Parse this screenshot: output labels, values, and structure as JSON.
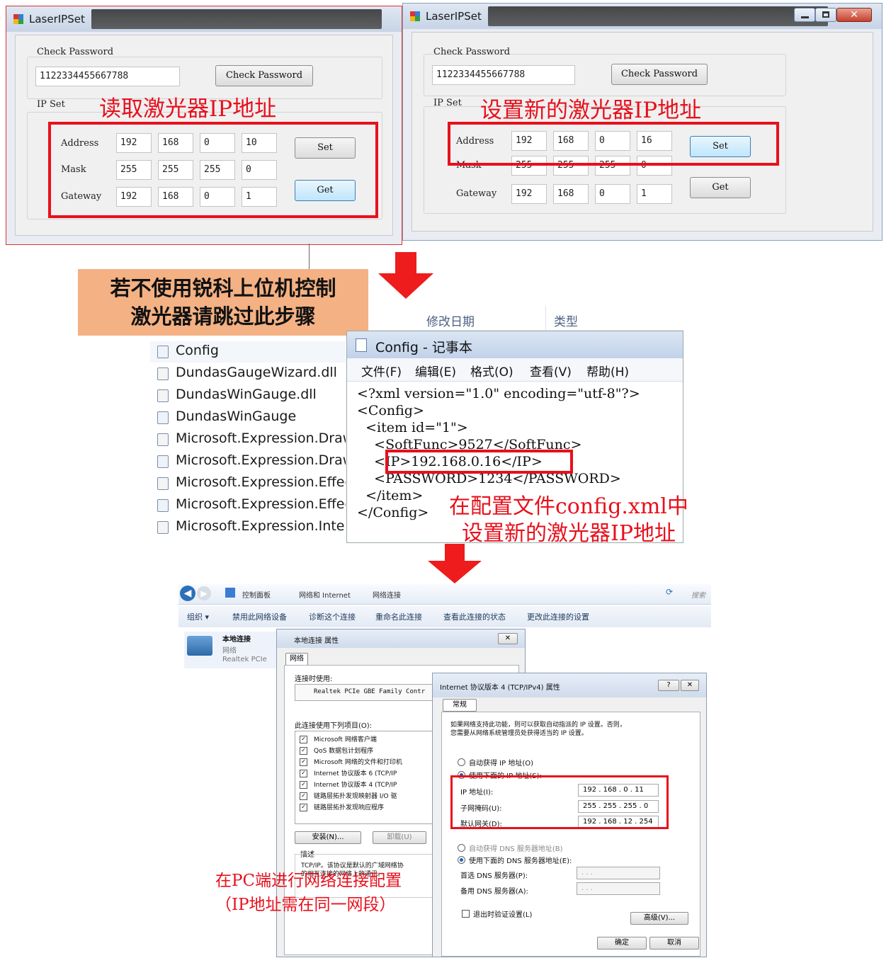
{
  "left_window": {
    "title": "LaserIPSet",
    "check_password_label": "Check Password",
    "password_value": "1122334455667788",
    "check_password_button": "Check Password",
    "ip_set_label": "IP Set",
    "annotation": "读取激光器IP地址",
    "address_label": "Address",
    "mask_label": "Mask",
    "gateway_label": "Gateway",
    "address": [
      "192",
      "168",
      "0",
      "10"
    ],
    "mask": [
      "255",
      "255",
      "255",
      "0"
    ],
    "gateway": [
      "192",
      "168",
      "0",
      "1"
    ],
    "set_button": "Set",
    "get_button": "Get"
  },
  "right_window": {
    "title": "LaserIPSet",
    "check_password_label": "Check Password",
    "password_value": "1122334455667788",
    "check_password_button": "Check Password",
    "ip_set_label": "IP Set",
    "annotation": "设置新的激光器IP地址",
    "address_label": "Address",
    "mask_label": "Mask",
    "gateway_label": "Gateway",
    "address": [
      "192",
      "168",
      "0",
      "16"
    ],
    "mask": [
      "255",
      "255",
      "255",
      "0"
    ],
    "gateway": [
      "192",
      "168",
      "0",
      "1"
    ],
    "set_button": "Set",
    "get_button": "Get",
    "minimize_icon": "minimize-icon",
    "maximize_icon": "maximize-icon",
    "close_icon": "close-icon"
  },
  "note": {
    "line1": "若不使用锐科上位机控制",
    "line2": "激光器请跳过此步骤"
  },
  "explorer": {
    "col_modified": "修改日期",
    "col_type": "类型",
    "files": [
      "Config",
      "DundasGaugeWizard.dll",
      "DundasWinGauge.dll",
      "DundasWinGauge",
      "Microsoft.Expression.Drawi",
      "Microsoft.Expression.Drawi",
      "Microsoft.Expression.Effects",
      "Microsoft.Expression.Effects",
      "Microsoft.Expression.Intera"
    ]
  },
  "notepad": {
    "title": "Config - 记事本",
    "menu": [
      "文件(F)",
      "编辑(E)",
      "格式(O)",
      "查看(V)",
      "帮助(H)"
    ],
    "lines": [
      "<?xml version=\"1.0\" encoding=\"utf-8\"?>",
      "<Config>",
      "  <item id=\"1\">",
      "    <SoftFunc>9527</SoftFunc>",
      "    <IP>192.168.0.16</IP>",
      "    <PASSWORD>1234</PASSWORD>",
      "  </item>",
      "</Config>"
    ],
    "annotation_line1": "在配置文件config.xml中",
    "annotation_line2": "设置新的激光器IP地址"
  },
  "network": {
    "breadcrumb": [
      "控制面板",
      "网络和 Internet",
      "网络连接"
    ],
    "search_placeholder": "搜索",
    "commands": [
      "组织 ▾",
      "禁用此网络设备",
      "诊断这个连接",
      "重命名此连接",
      "查看此连接的状态",
      "更改此连接的设置"
    ],
    "adapter_name": "本地连接",
    "adapter_line2": "网络",
    "adapter_line3": "Realtek PCIe",
    "props_title": "本地连接 属性",
    "props_tab": "网络",
    "connect_using": "连接时使用:",
    "nic": "Realtek PCIe GBE Family Contr",
    "items_label": "此连接使用下列项目(O):",
    "items": [
      "Microsoft 网络客户端",
      "QoS 数据包计划程序",
      "Microsoft 网络的文件和打印机",
      "Internet 协议版本 6 (TCP/IP",
      "Internet 协议版本 4 (TCP/IP",
      "链路层拓扑发现映射器 I/O 驱",
      "链路层拓扑发现响应程序"
    ],
    "install_button": "安装(N)...",
    "uninstall_button": "卸载(U)",
    "desc_label": "描述",
    "desc_text1": "TCP/IP。该协议是默认的广域网络协",
    "desc_text2": "的相互连接的网络上的通讯。",
    "ipv4_title": "Internet 协议版本 4 (TCP/IPv4) 属性",
    "ipv4_tab": "常规",
    "ipv4_intro1": "如果网络支持此功能，则可以获取自动指派的 IP 设置。否则，",
    "ipv4_intro2": "您需要从网络系统管理员处获得适当的 IP 设置。",
    "auto_ip": "自动获得 IP 地址(O)",
    "manual_ip": "使用下面的 IP 地址(S):",
    "ip_label": "IP 地址(I):",
    "mask_label": "子网掩码(U):",
    "gw_label": "默认网关(D):",
    "ip_value": "192 . 168 . 0 . 11",
    "mask_value": "255 . 255 . 255 . 0",
    "gw_value": "192 . 168 . 12 . 254",
    "auto_dns": "自动获得 DNS 服务器地址(B)",
    "manual_dns": "使用下面的 DNS 服务器地址(E):",
    "dns1_label": "首选 DNS 服务器(P):",
    "dns2_label": "备用 DNS 服务器(A):",
    "dns_empty": ".     .     .",
    "validate_label": "退出时验证设置(L)",
    "advanced_button": "高级(V)...",
    "ok_button": "确定",
    "cancel_button": "取消",
    "annotation_line1": "在PC端进行网络连接配置",
    "annotation_line2": "（IP地址需在同一网段）"
  },
  "colors": {
    "annotation_red": "#e8101c",
    "note_orange": "#f4b183",
    "arrow_red": "#ee1c1c"
  }
}
